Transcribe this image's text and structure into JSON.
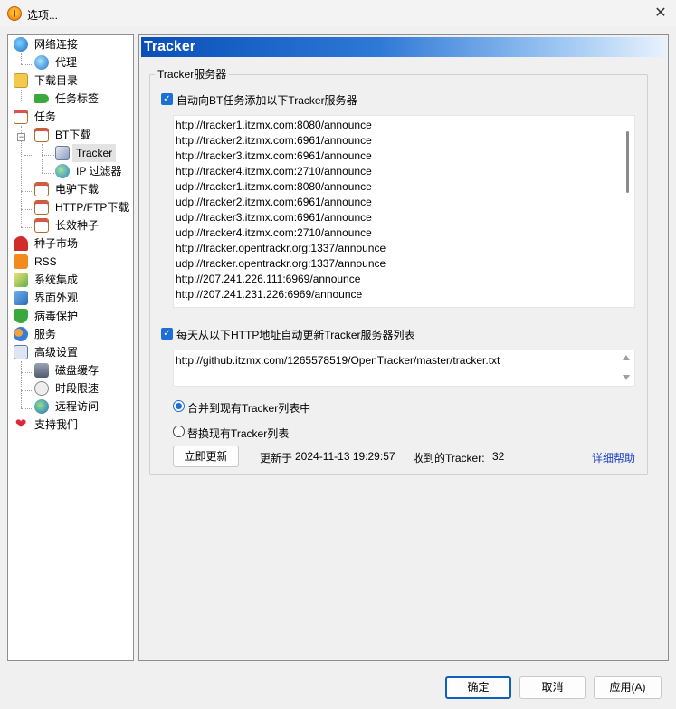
{
  "window": {
    "title": "选项...",
    "close_glyph": "✕",
    "app_icon": "app-icon"
  },
  "tree": [
    {
      "label": "网络连接",
      "icon": "globe-network-icon"
    },
    {
      "label": "代理",
      "icon": "globe-proxy-icon"
    },
    {
      "label": "下载目录",
      "icon": "folder-open-icon"
    },
    {
      "label": "任务标签",
      "icon": "tag-icon"
    },
    {
      "label": "任务",
      "icon": "task-clipboard-icon"
    },
    {
      "label": "BT下载",
      "icon": "bt-task-icon"
    },
    {
      "label": "Tracker",
      "icon": "tracker-cube-icon"
    },
    {
      "label": "IP 过滤器",
      "icon": "ip-filter-icon"
    },
    {
      "label": "电驴下载",
      "icon": "ed2k-task-icon"
    },
    {
      "label": "HTTP/FTP下载",
      "icon": "http-task-icon"
    },
    {
      "label": "长效种子",
      "icon": "long-seed-icon"
    },
    {
      "label": "种子市场",
      "icon": "magnet-icon"
    },
    {
      "label": "RSS",
      "icon": "rss-icon"
    },
    {
      "label": "系统集成",
      "icon": "system-integration-icon"
    },
    {
      "label": "界面外观",
      "icon": "appearance-icon"
    },
    {
      "label": "病毒保护",
      "icon": "shield-icon"
    },
    {
      "label": "服务",
      "icon": "users-icon"
    },
    {
      "label": "高级设置",
      "icon": "advanced-settings-icon"
    },
    {
      "label": "磁盘缓存",
      "icon": "disk-cache-icon"
    },
    {
      "label": "时段限速",
      "icon": "schedule-icon"
    },
    {
      "label": "远程访问",
      "icon": "remote-globe-icon"
    },
    {
      "label": "支持我们",
      "icon": "heart-icon"
    }
  ],
  "panel": {
    "header": "Tracker",
    "group_title": "Tracker服务器",
    "auto_add_label": "自动向BT任务添加以下Tracker服务器",
    "auto_add_checked": true,
    "trackers": [
      "http://tracker1.itzmx.com:8080/announce",
      "http://tracker2.itzmx.com:6961/announce",
      "http://tracker3.itzmx.com:6961/announce",
      "http://tracker4.itzmx.com:2710/announce",
      "udp://tracker1.itzmx.com:8080/announce",
      "udp://tracker2.itzmx.com:6961/announce",
      "udp://tracker3.itzmx.com:6961/announce",
      "udp://tracker4.itzmx.com:2710/announce",
      "http://tracker.opentrackr.org:1337/announce",
      "udp://tracker.opentrackr.org:1337/announce",
      "http://207.241.226.111:6969/announce",
      "http://207.241.231.226:6969/announce"
    ],
    "auto_update_label": "每天从以下HTTP地址自动更新Tracker服务器列表",
    "auto_update_checked": true,
    "update_url": "http://github.itzmx.com/1265578519/OpenTracker/master/tracker.txt",
    "merge_label": "合并到现有Tracker列表中",
    "replace_label": "替换现有Tracker列表",
    "selected_mode": "merge",
    "update_now_label": "立即更新",
    "status_prefix": "更新于",
    "status_date": "2024-11-13 19:29:57",
    "status_received": "收到的Tracker:",
    "status_count": "32",
    "help_link": "详细帮助"
  },
  "footer": {
    "ok_label": "确定",
    "cancel_label": "取消",
    "apply_label": "应用(A)"
  },
  "colors": {
    "accent": "#1d6fd4",
    "header_start": "#0a4fb9",
    "link": "#1d3fc9"
  }
}
